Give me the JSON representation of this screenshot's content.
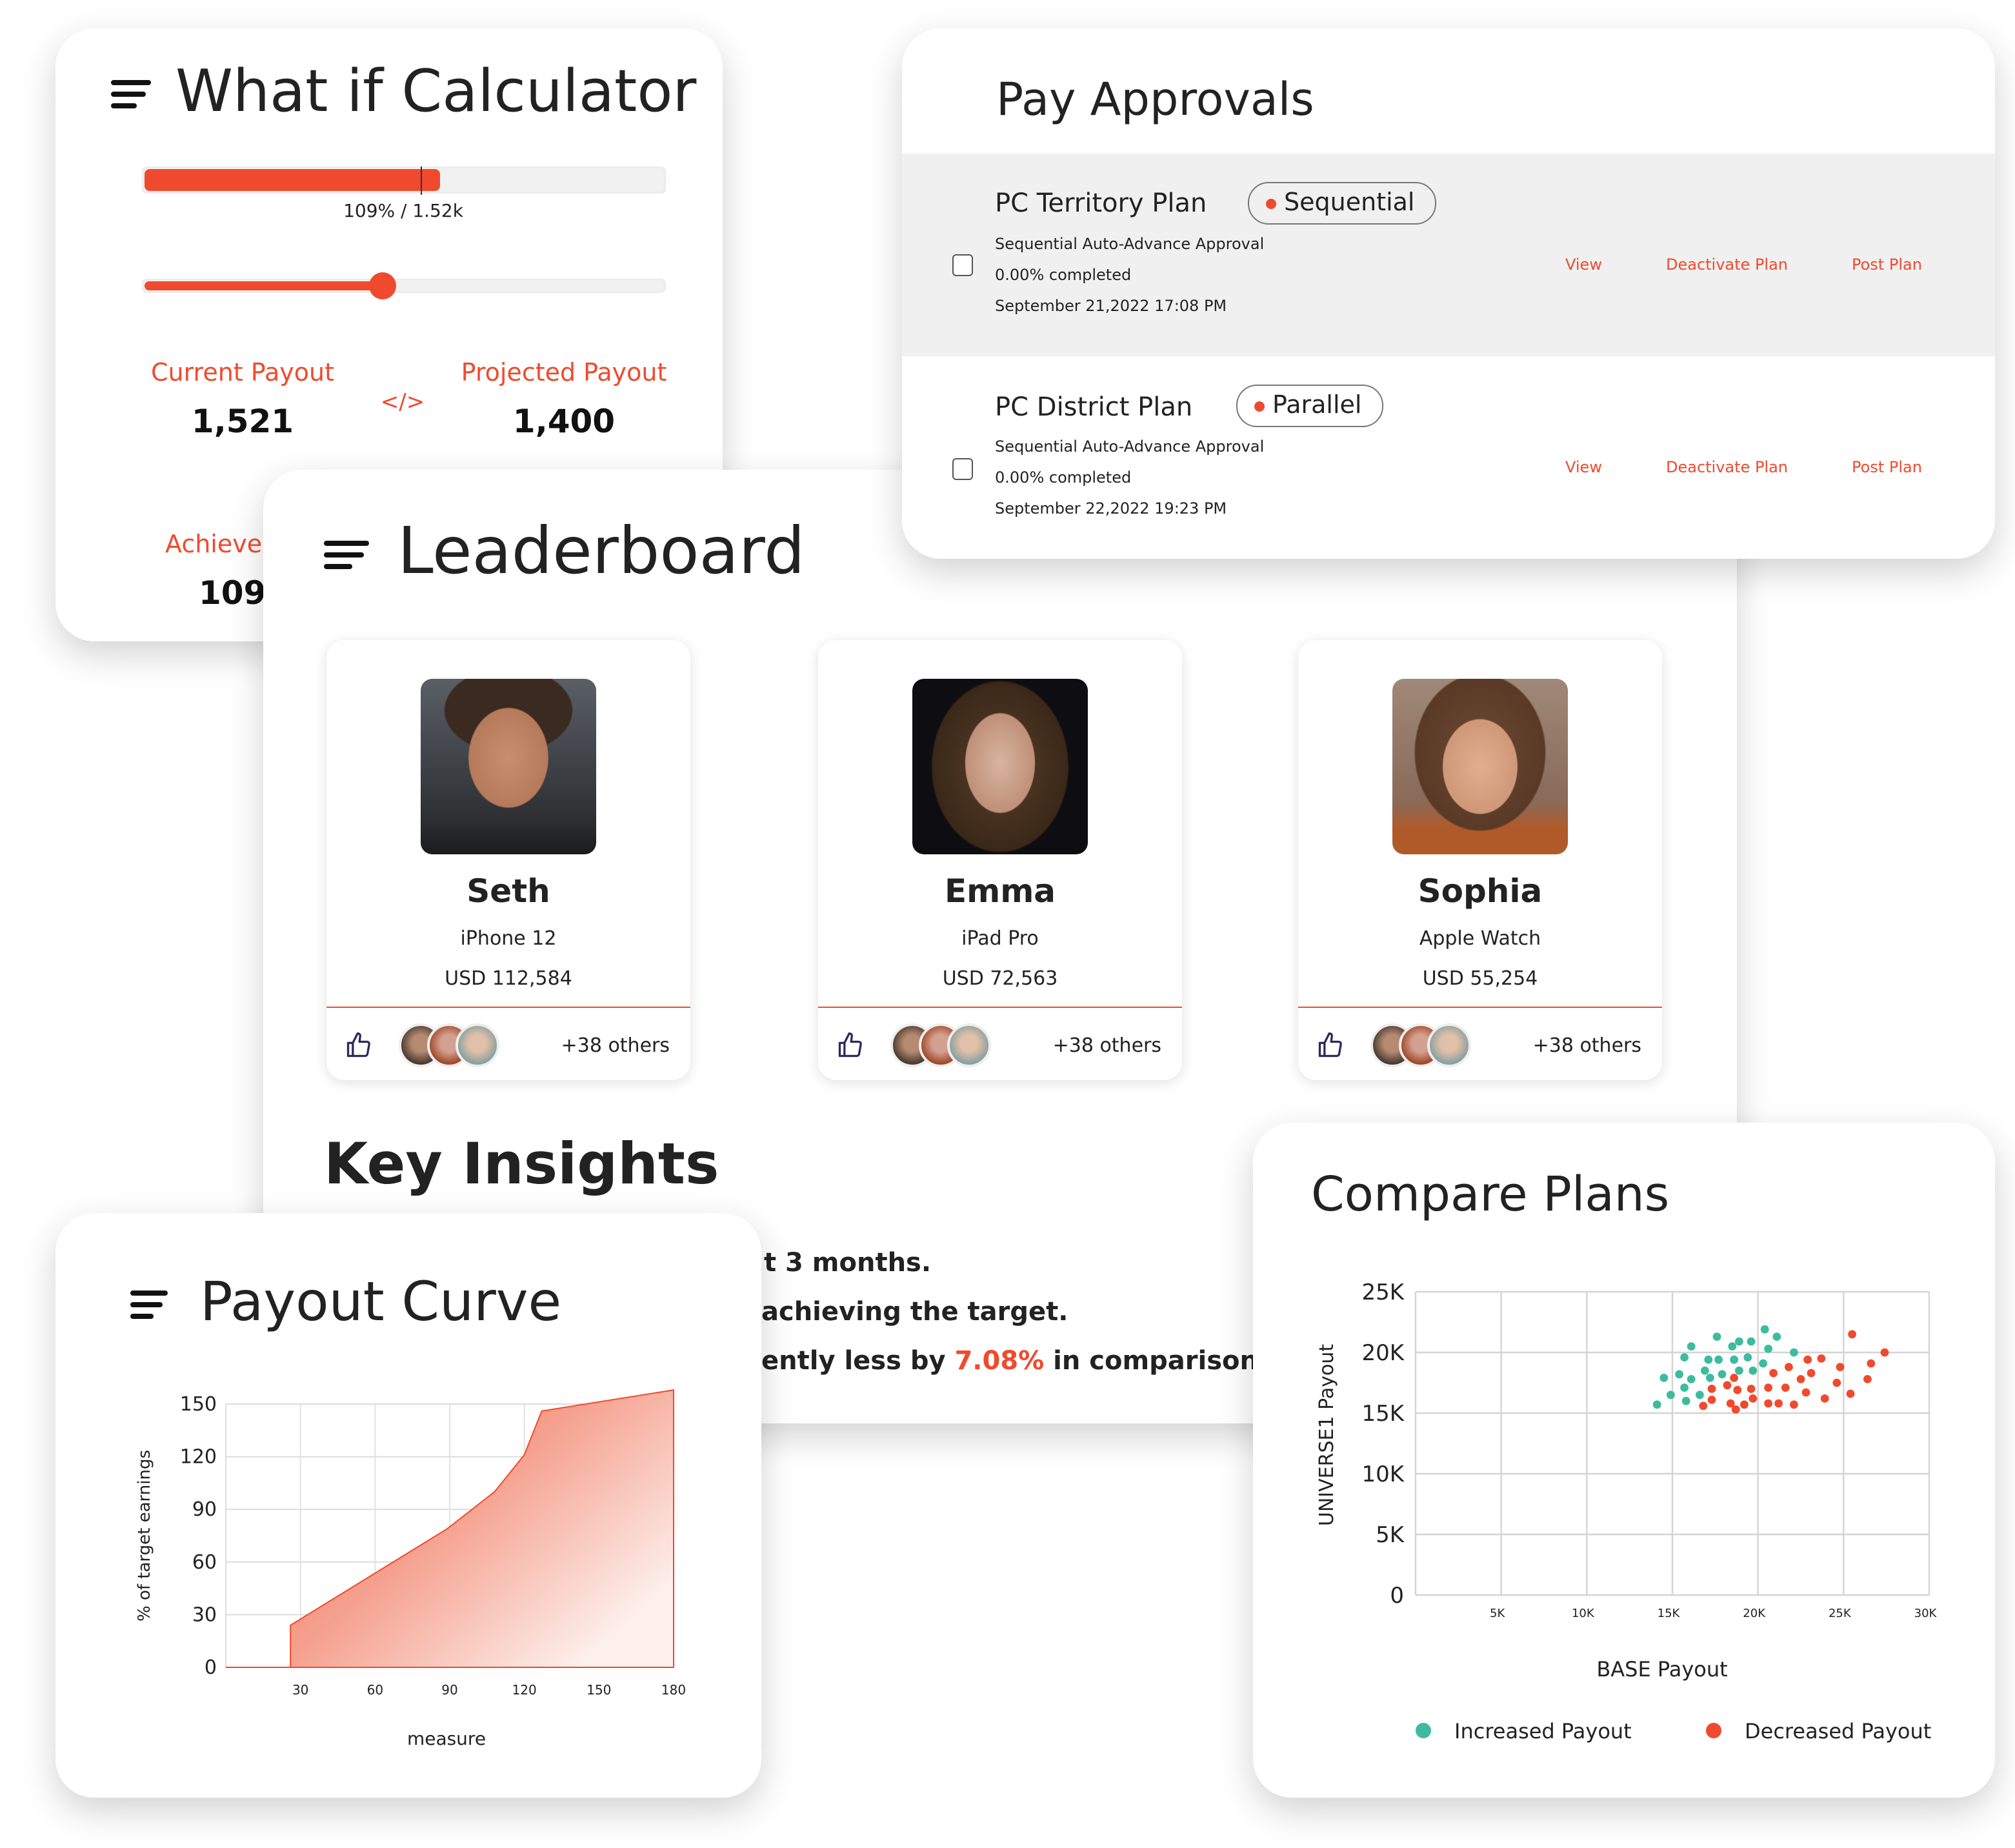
{
  "colors": {
    "accent": "#f04a2e",
    "teal": "#3dbb9f"
  },
  "calculator": {
    "title": "What if Calculator",
    "menu_icon": "hamburger-menu-icon",
    "progress": {
      "percent_filled": 57,
      "label": "109% / 1.52k"
    },
    "slider": {
      "value_percent": 46
    },
    "current_payout": {
      "label": "Current Payout",
      "value": "1,521"
    },
    "compare_symbol": "</>",
    "projected_payout": {
      "label": "Projected Payout",
      "value": "1,400"
    },
    "achievement": {
      "label": "Achiever",
      "value": "109"
    }
  },
  "pay_approvals": {
    "title": "Pay Approvals",
    "plans": [
      {
        "name": "PC Territory Plan",
        "badge": "Sequential",
        "type": "Sequential Auto-Advance Approval",
        "progress": "0.00% completed",
        "date": "September 21,2022 17:08 PM",
        "actions": [
          "View",
          "Deactivate Plan",
          "Post Plan"
        ],
        "checked": false
      },
      {
        "name": "PC District Plan",
        "badge": "Parallel",
        "type": "Sequential Auto-Advance Approval",
        "progress": "0.00% completed",
        "date": "September 22,2022 19:23 PM",
        "actions": [
          "View",
          "Deactivate Plan",
          "Post Plan"
        ],
        "checked": false
      }
    ]
  },
  "leaderboard": {
    "title": "Leaderboard",
    "people": [
      {
        "name": "Seth",
        "product": "iPhone 12",
        "amount": "USD 112,584",
        "others": "+38 others"
      },
      {
        "name": "Emma",
        "product": "iPad Pro",
        "amount": "USD 72,563",
        "others": "+38 others"
      },
      {
        "name": "Sophia",
        "product": "Apple Watch",
        "amount": "USD 55,254",
        "others": "+38 others"
      }
    ],
    "key_insights": {
      "title": "Key Insights",
      "lines": [
        {
          "text": "t 3 months."
        },
        {
          "text": "achieving the target."
        },
        {
          "before": "ently less by ",
          "highlight": "7.08%",
          "after": " in comparison with"
        }
      ]
    }
  },
  "chart_data": [
    {
      "type": "area",
      "title": "Payout Curve",
      "xlabel": "measure",
      "ylabel": "% of target earnings",
      "xlim": [
        0,
        180
      ],
      "ylim": [
        0,
        150
      ],
      "xticks": [
        30,
        60,
        90,
        120,
        150,
        180
      ],
      "yticks": [
        0,
        30,
        60,
        90,
        120,
        150
      ],
      "grid": true,
      "x": [
        0,
        26,
        26,
        89,
        108,
        120,
        127,
        180
      ],
      "y": [
        0,
        0,
        24,
        79,
        100,
        121,
        146,
        158
      ]
    },
    {
      "type": "scatter",
      "title": "Compare Plans",
      "xlabel": "BASE Payout",
      "ylabel": "UNIVERSE1 Payout",
      "xlim": [
        0,
        30000
      ],
      "ylim": [
        0,
        25000
      ],
      "xticks": [
        {
          "v": 5000,
          "label": "5K"
        },
        {
          "v": 10000,
          "label": "10K"
        },
        {
          "v": 15000,
          "label": "15K"
        },
        {
          "v": 20000,
          "label": "20K"
        },
        {
          "v": 25000,
          "label": "25K"
        },
        {
          "v": 30000,
          "label": "30K"
        }
      ],
      "yticks": [
        {
          "v": 0,
          "label": "0"
        },
        {
          "v": 5000,
          "label": "5K"
        },
        {
          "v": 10000,
          "label": "10K"
        },
        {
          "v": 15000,
          "label": "15K"
        },
        {
          "v": 20000,
          "label": "20K"
        },
        {
          "v": 25000,
          "label": "25K"
        }
      ],
      "grid": true,
      "legend": "bottom",
      "series": [
        {
          "name": "Increased Payout",
          "color": "#3dbb9f",
          "points": [
            [
              14100,
              15700
            ],
            [
              14500,
              17900
            ],
            [
              14900,
              16500
            ],
            [
              15400,
              18200
            ],
            [
              15700,
              19600
            ],
            [
              15700,
              17100
            ],
            [
              15800,
              16000
            ],
            [
              16100,
              20500
            ],
            [
              16100,
              17800
            ],
            [
              16600,
              16500
            ],
            [
              16900,
              18500
            ],
            [
              17100,
              19400
            ],
            [
              17200,
              17900
            ],
            [
              17600,
              21300
            ],
            [
              17700,
              19400
            ],
            [
              17900,
              18200
            ],
            [
              18500,
              20500
            ],
            [
              18600,
              19400
            ],
            [
              18900,
              20900
            ],
            [
              18900,
              18500
            ],
            [
              19400,
              19600
            ],
            [
              19600,
              20900
            ],
            [
              19700,
              18500
            ],
            [
              20300,
              19100
            ],
            [
              20400,
              21900
            ],
            [
              20600,
              20300
            ],
            [
              21100,
              21300
            ],
            [
              22100,
              20000
            ]
          ]
        },
        {
          "name": "Decreased Payout",
          "color": "#f04a2e",
          "points": [
            [
              16800,
              15600
            ],
            [
              17300,
              17000
            ],
            [
              17300,
              16100
            ],
            [
              18200,
              17300
            ],
            [
              18400,
              15800
            ],
            [
              18600,
              17900
            ],
            [
              18700,
              15300
            ],
            [
              18800,
              16900
            ],
            [
              19200,
              15700
            ],
            [
              19600,
              17000
            ],
            [
              19700,
              16200
            ],
            [
              20600,
              17100
            ],
            [
              20600,
              15800
            ],
            [
              20900,
              18300
            ],
            [
              21200,
              15800
            ],
            [
              21600,
              17100
            ],
            [
              21800,
              18800
            ],
            [
              22100,
              15700
            ],
            [
              22500,
              17800
            ],
            [
              22800,
              16700
            ],
            [
              22900,
              19400
            ],
            [
              23100,
              18300
            ],
            [
              23700,
              19500
            ],
            [
              23900,
              16200
            ],
            [
              24600,
              17500
            ],
            [
              24800,
              18800
            ],
            [
              25400,
              16600
            ],
            [
              25500,
              21500
            ],
            [
              26400,
              17800
            ],
            [
              26600,
              19100
            ],
            [
              27400,
              20000
            ]
          ]
        }
      ]
    }
  ]
}
